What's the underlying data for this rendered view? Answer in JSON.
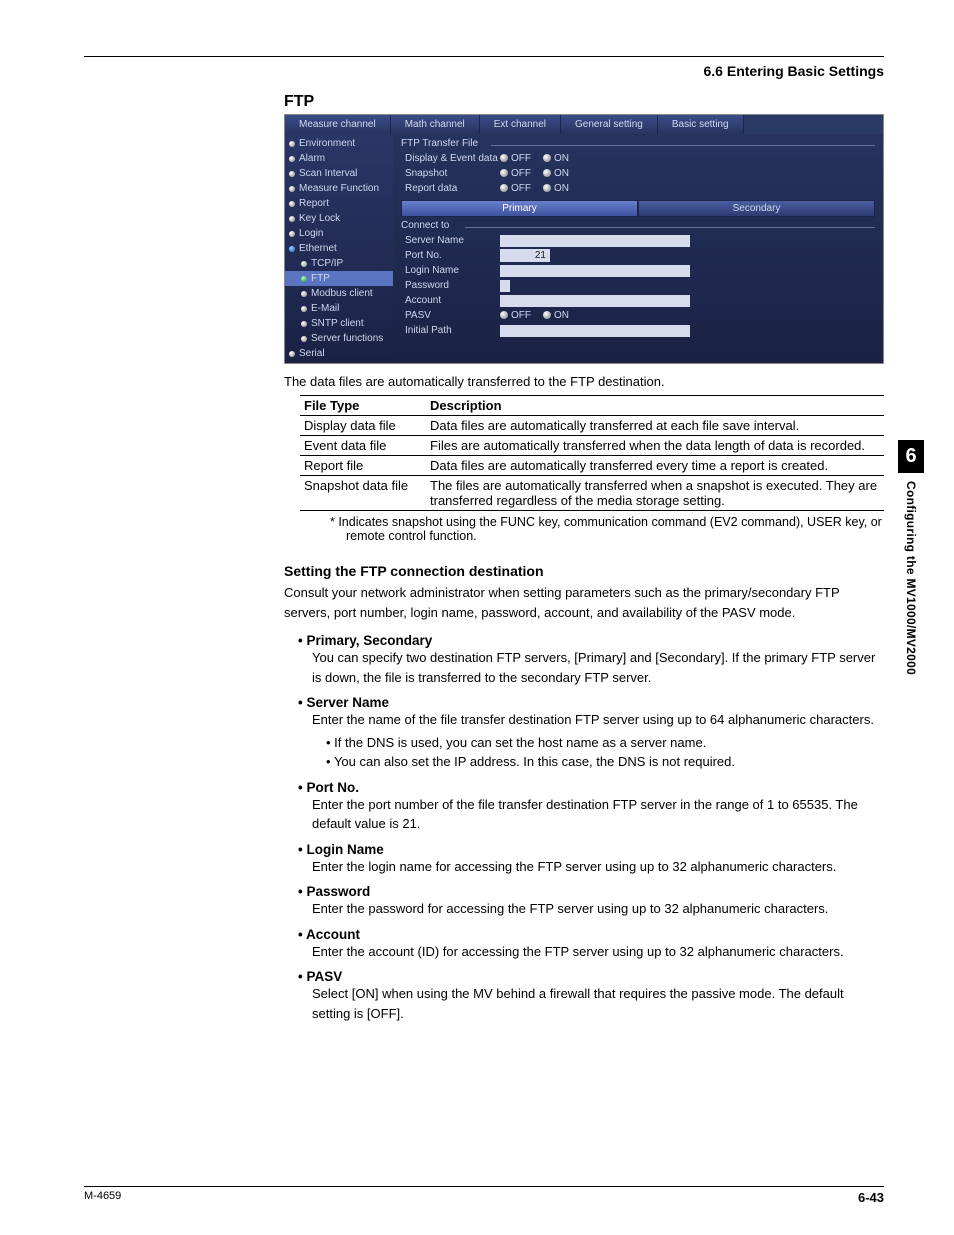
{
  "header": {
    "section": "6.6  Entering Basic Settings"
  },
  "ftp_heading": "FTP",
  "mock": {
    "tabs": [
      "Measure channel",
      "Math channel",
      "Ext channel",
      "General setting",
      "Basic setting"
    ],
    "sidebar": [
      {
        "label": "Environment",
        "cls": ""
      },
      {
        "label": "Alarm",
        "cls": ""
      },
      {
        "label": "Scan Interval",
        "cls": ""
      },
      {
        "label": "Measure Function",
        "cls": ""
      },
      {
        "label": "Report",
        "cls": ""
      },
      {
        "label": "Key Lock",
        "cls": ""
      },
      {
        "label": "Login",
        "cls": ""
      },
      {
        "label": "Ethernet",
        "cls": "blue"
      },
      {
        "label": "TCP/IP",
        "cls": "sub"
      },
      {
        "label": "FTP",
        "cls": "sub green sel"
      },
      {
        "label": "Modbus client",
        "cls": "sub"
      },
      {
        "label": "E-Mail",
        "cls": "sub"
      },
      {
        "label": "SNTP client",
        "cls": "sub"
      },
      {
        "label": "Server functions",
        "cls": "sub"
      },
      {
        "label": "Serial",
        "cls": ""
      }
    ],
    "group1": "FTP Transfer File",
    "rows1": [
      {
        "label": "Display & Event data",
        "type": "radio"
      },
      {
        "label": "Snapshot",
        "type": "radio"
      },
      {
        "label": "Report data",
        "type": "radio"
      }
    ],
    "radio_off": "OFF",
    "radio_on": "ON",
    "subtabs": [
      "Primary",
      "Secondary"
    ],
    "group2": "Connect to",
    "rows2": [
      {
        "label": "Server Name",
        "type": "text"
      },
      {
        "label": "Port No.",
        "type": "small",
        "value": "21"
      },
      {
        "label": "Login Name",
        "type": "text"
      },
      {
        "label": "Password",
        "type": "tiny"
      },
      {
        "label": "Account",
        "type": "text"
      },
      {
        "label": "PASV",
        "type": "radio"
      },
      {
        "label": "Initial Path",
        "type": "text"
      }
    ]
  },
  "caption": "The data files are automatically transferred to the FTP destination.",
  "table": {
    "headers": [
      "File Type",
      "Description"
    ],
    "rows": [
      [
        "Display data file",
        "Data files are automatically transferred at each file save interval."
      ],
      [
        "Event data file",
        "Files are automatically transferred when the data length of data is recorded."
      ],
      [
        "Report file",
        "Data files are automatically transferred every time a report is created."
      ],
      [
        "Snapshot data file",
        "The files are automatically transferred when a snapshot is executed. They are transferred regardless of the media storage setting."
      ]
    ]
  },
  "footnote": "*   Indicates snapshot using the FUNC key, communication command (EV2 command), USER key, or remote control function.",
  "subhead": "Setting the FTP connection destination",
  "intro": "Consult your network administrator when setting parameters such as the primary/secondary FTP servers, port number, login name, password, account, and availability of the PASV mode.",
  "bullets": [
    {
      "title": "Primary, Secondary",
      "body": "You can specify two destination FTP servers, [Primary] and [Secondary].  If the primary FTP server is down, the file is transferred to the secondary FTP server."
    },
    {
      "title": "Server Name",
      "body": "Enter the name of the file transfer destination FTP server using up to 64 alphanumeric characters.",
      "inner": [
        "If the DNS is used, you can set the host name as a server name.",
        "You can also set the IP address.  In this case, the DNS is not required."
      ]
    },
    {
      "title": "Port No.",
      "body": "Enter the port number of the file transfer destination FTP server in the range of 1 to 65535.  The default value is 21."
    },
    {
      "title": "Login Name",
      "body": "Enter the login name for accessing the FTP server using up to 32 alphanumeric characters."
    },
    {
      "title": "Password",
      "body": "Enter the password for accessing the FTP server using up to 32 alphanumeric characters."
    },
    {
      "title": "Account",
      "body": "Enter the account (ID) for accessing the FTP server using up to 32 alphanumeric characters."
    },
    {
      "title": "PASV",
      "body": "Select [ON] when using the MV behind a firewall that requires the passive mode. The default setting is [OFF]."
    }
  ],
  "sidetab": {
    "chapter": "6",
    "title": "Configuring the MV1000/MV2000"
  },
  "footer": {
    "left": "M-4659",
    "right": "6-43"
  }
}
